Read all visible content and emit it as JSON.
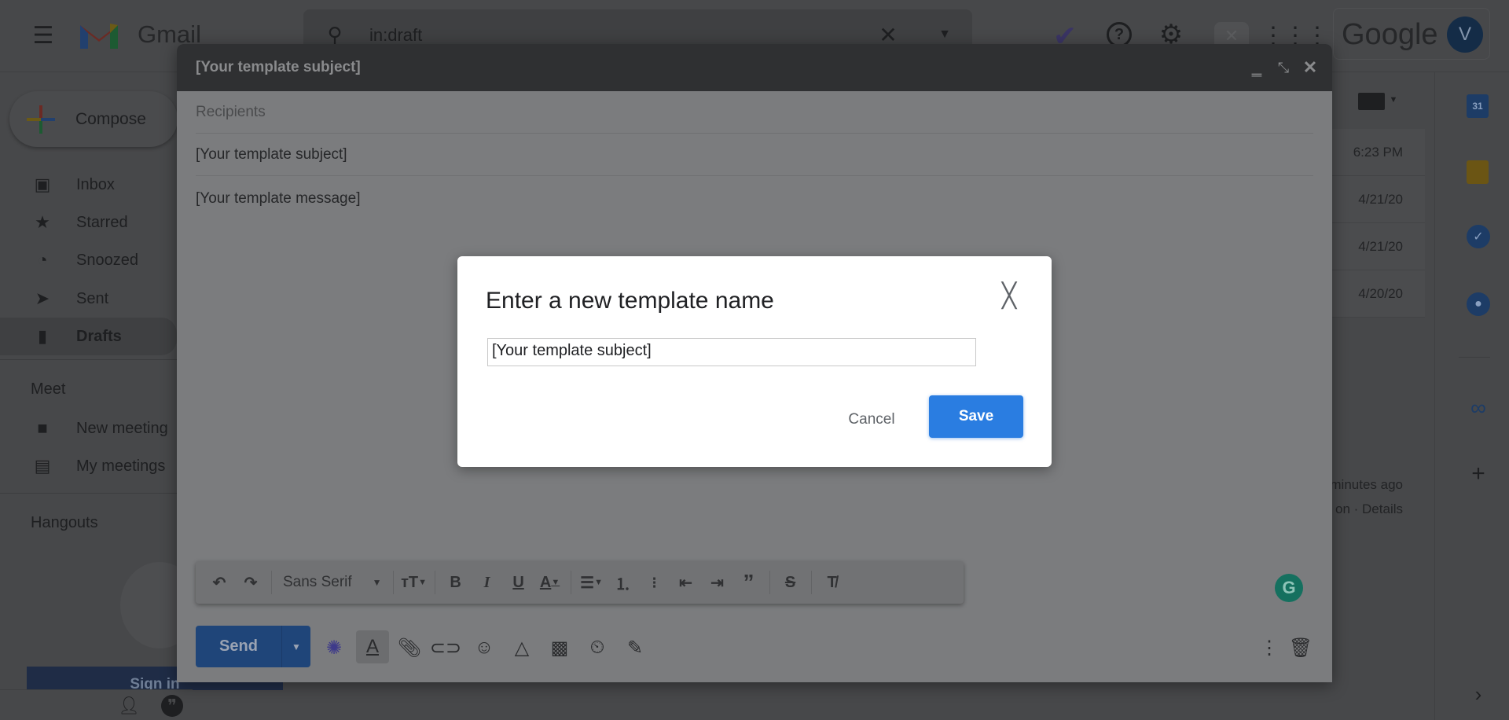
{
  "app": {
    "name": "Gmail",
    "brand_logo": "Google",
    "avatar_letter": "V"
  },
  "search": {
    "value": "in:draft"
  },
  "compose_button": {
    "label": "Compose"
  },
  "sidebar": {
    "items": [
      {
        "label": "Inbox",
        "icon": "inbox-icon"
      },
      {
        "label": "Starred",
        "icon": "star-icon"
      },
      {
        "label": "Snoozed",
        "icon": "clock-icon"
      },
      {
        "label": "Sent",
        "icon": "send-icon"
      },
      {
        "label": "Drafts",
        "icon": "draft-icon",
        "active": true
      }
    ],
    "meet": {
      "title": "Meet",
      "items": [
        {
          "label": "New meeting"
        },
        {
          "label": "My meetings"
        }
      ]
    },
    "hangouts": {
      "title": "Hangouts",
      "sign_in": "Sign in"
    }
  },
  "list": {
    "times": [
      "6:23 PM",
      "4/21/20",
      "4/21/20",
      "4/20/20"
    ],
    "activity": "minutes ago",
    "details": "on · Details"
  },
  "compose": {
    "title": "[Your template subject]",
    "recipients_placeholder": "Recipients",
    "subject": "[Your template subject]",
    "message": "[Your template message]",
    "font": "Sans Serif",
    "send_label": "Send"
  },
  "dialog": {
    "title": "Enter a new template name",
    "input_value": "[Your template subject]",
    "cancel": "Cancel",
    "save": "Save",
    "accent": "#2a7de1"
  }
}
